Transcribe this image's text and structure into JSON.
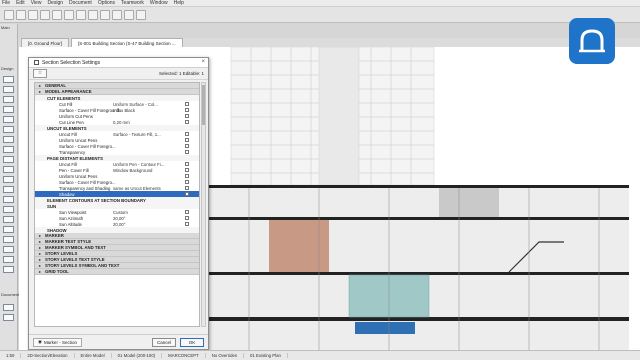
{
  "menubar": {
    "items": [
      "File",
      "Edit",
      "View",
      "Design",
      "Document",
      "Options",
      "Teamwork",
      "Window",
      "Help"
    ]
  },
  "toolbox": {
    "label": "Main",
    "section1": "Design",
    "section2": "Document"
  },
  "tabs": [
    {
      "label": "[0. Ground Floor]"
    },
    {
      "label": "[S-001 Building Section (S-47 Building Section ..."
    }
  ],
  "dialog": {
    "title": "Section Selection Settings",
    "selected": "Selected: 1 Editable: 1",
    "footer": {
      "display": "Marker - Section",
      "cancel": "Cancel",
      "ok": "OK"
    },
    "rows": [
      {
        "kind": "panel",
        "label": "GENERAL"
      },
      {
        "kind": "panel",
        "label": "MODEL APPEARANCE"
      },
      {
        "kind": "grp",
        "label": "CUT ELEMENTS"
      },
      {
        "kind": "item",
        "label": "Cut Fill",
        "value": "Uniform Surface - Col..."
      },
      {
        "kind": "item",
        "label": "Surface - Cover Fill Foreground",
        "value": "Inflax Black"
      },
      {
        "kind": "item",
        "label": "Uniform Cut Pens",
        "value": ""
      },
      {
        "kind": "item",
        "label": "Cut Line Pen",
        "value": "0,20 mm"
      },
      {
        "kind": "grp",
        "label": "UNCUT ELEMENTS"
      },
      {
        "kind": "item",
        "label": "Uncut Fill",
        "value": "Surface - Texture Fill, 1..."
      },
      {
        "kind": "item",
        "label": "Uniform Uncut Pens",
        "value": ""
      },
      {
        "kind": "item",
        "label": "Surface - Cover Fill Foregro...",
        "value": ""
      },
      {
        "kind": "item",
        "label": "Transparency",
        "value": ""
      },
      {
        "kind": "grp",
        "label": "PAGE DISTANT ELEMENTS"
      },
      {
        "kind": "item",
        "label": "Uncut Fill",
        "value": "Uniform Pen - Contour Fi..."
      },
      {
        "kind": "item",
        "label": "Pen - Cover Fill",
        "value": "Window Background"
      },
      {
        "kind": "item",
        "label": "Uniform Uncut Pens",
        "value": ""
      },
      {
        "kind": "item",
        "label": "Surface - Cover Fill Foregro...",
        "value": ""
      },
      {
        "kind": "item",
        "label": "Transparency and Shading",
        "value": "same as Uncut Elements"
      },
      {
        "kind": "item",
        "label": "Shadow",
        "value": "",
        "selected": true
      },
      {
        "kind": "grp",
        "label": "ELEMENT CONTOURS AT SECTION BOUNDARY"
      },
      {
        "kind": "grp",
        "label": "SUN"
      },
      {
        "kind": "item",
        "label": "Sun Viewpoint",
        "value": "Custom"
      },
      {
        "kind": "item",
        "label": "Sun Azimuth",
        "value": "20,00°"
      },
      {
        "kind": "item",
        "label": "Sun Altitude",
        "value": "20,00°"
      },
      {
        "kind": "grp",
        "label": "SHADOW"
      },
      {
        "kind": "panel",
        "label": "MARKER"
      },
      {
        "kind": "panel",
        "label": "MARKER TEXT STYLE"
      },
      {
        "kind": "panel",
        "label": "MARKER SYMBOL AND TEXT"
      },
      {
        "kind": "panel",
        "label": "STORY LEVELS"
      },
      {
        "kind": "panel",
        "label": "STORY LEVELS TEXT STYLE"
      },
      {
        "kind": "panel",
        "label": "STORY LEVELS SYMBOL AND TEXT"
      },
      {
        "kind": "panel",
        "label": "GRID TOOL"
      }
    ]
  },
  "statusbar": [
    "1:50",
    "2D-Section/Elevation",
    "Entire Model",
    "01 Model (200-100)",
    "MARCONCEPT",
    "No Overrides",
    "01 Existing Plan"
  ],
  "colors": {
    "accent": "#2e6bbf",
    "logo": "#1f73c9"
  }
}
